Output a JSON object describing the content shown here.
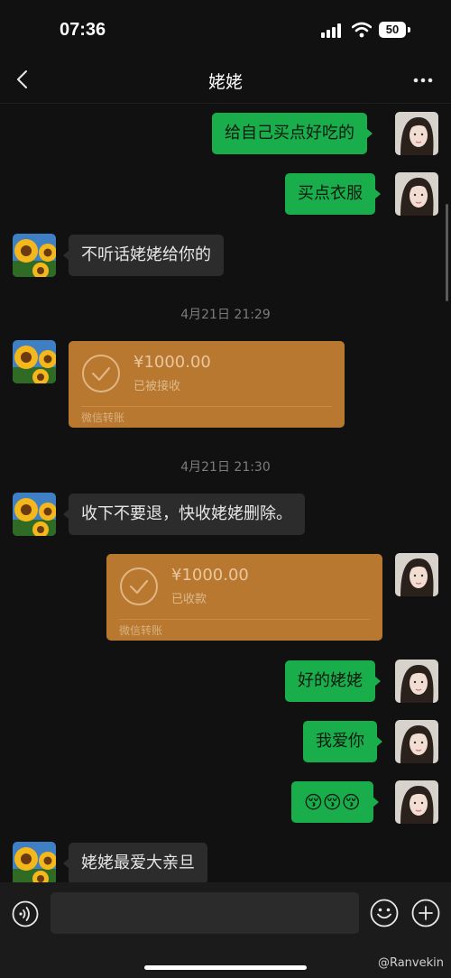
{
  "status": {
    "time": "07:36",
    "battery": "50"
  },
  "nav": {
    "title": "姥姥"
  },
  "messages": {
    "m1": "给自己买点好吃的",
    "m2": "买点衣服",
    "m3": "不听话姥姥给你的",
    "ts1": "4月21日 21:29",
    "t1": {
      "amount": "¥1000.00",
      "state": "已被接收",
      "footer": "微信转账"
    },
    "ts2": "4月21日 21:30",
    "m4": "收下不要退，快收姥姥删除。",
    "t2": {
      "amount": "¥1000.00",
      "state": "已收款",
      "footer": "微信转账"
    },
    "m5": "好的姥姥",
    "m6": "我爱你",
    "m7": "😚😚😚",
    "m8": "姥姥最爱大亲旦"
  },
  "watermark": "@Ranvekin",
  "colors": {
    "outgoing": "#1aad4b",
    "incoming": "#2c2c2c",
    "transfer": "#b8782f",
    "background": "#111111"
  }
}
